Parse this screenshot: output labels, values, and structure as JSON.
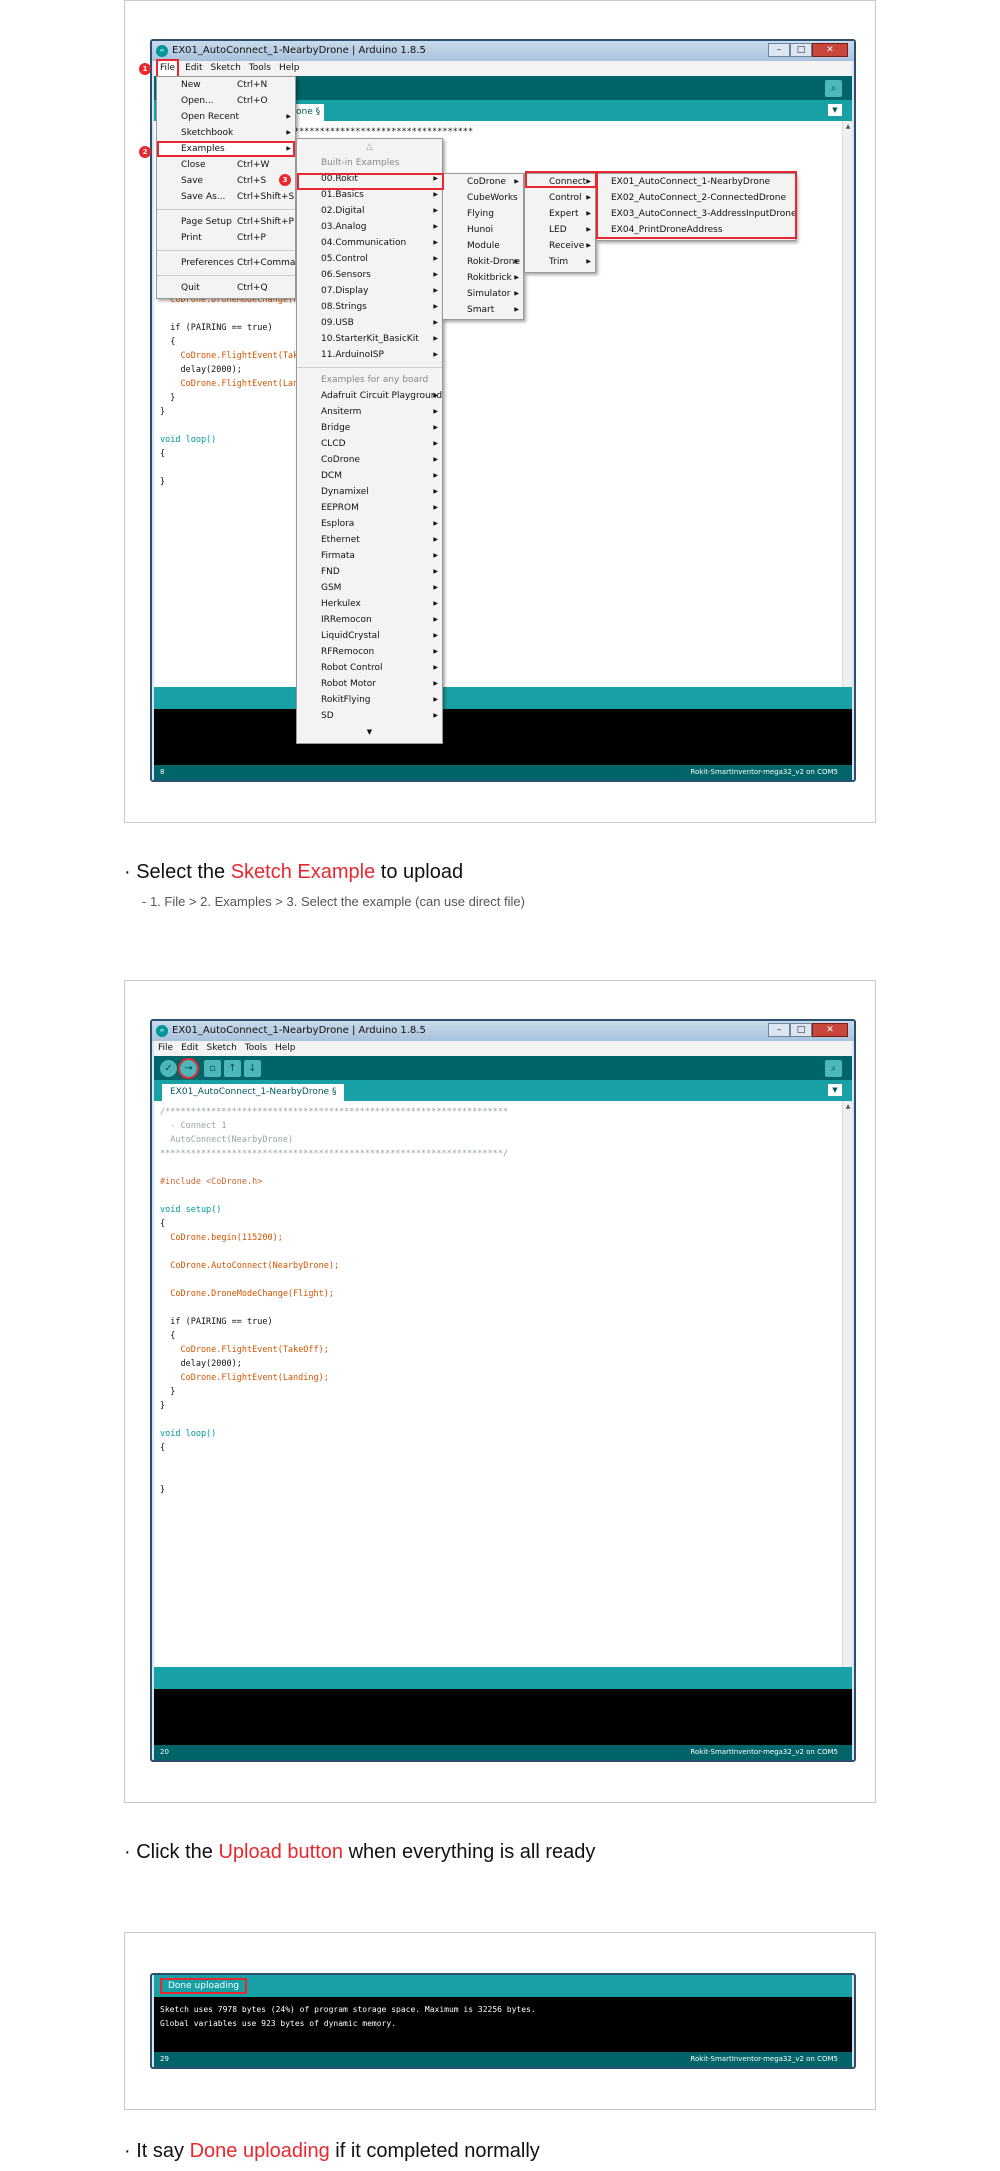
{
  "window": {
    "title": "EX01_AutoConnect_1-NearbyDrone | Arduino 1.8.5",
    "app_icon": "∞",
    "controls": {
      "minimize": "–",
      "maximize": "□",
      "close": "✕"
    }
  },
  "menubar": {
    "file": "File",
    "edit": "Edit",
    "sketch": "Sketch",
    "tools": "Tools",
    "help": "Help"
  },
  "toolbar": {
    "verify": "✓",
    "upload": "→",
    "new": "▫",
    "open": "↑",
    "save": "↓",
    "serial_monitor": "⌕"
  },
  "tab": {
    "name": "EX01_AutoConnect_1-NearbyDrone §",
    "name_partial": "one §",
    "menu": "▼"
  },
  "file_menu": {
    "items": [
      {
        "label": "New",
        "shortcut": "Ctrl+N"
      },
      {
        "label": "Open...",
        "shortcut": "Ctrl+O"
      },
      {
        "label": "Open Recent",
        "shortcut": ""
      },
      {
        "label": "Sketchbook",
        "shortcut": ""
      },
      {
        "label": "Examples",
        "shortcut": ""
      },
      {
        "label": "Close",
        "shortcut": "Ctrl+W"
      },
      {
        "label": "Save",
        "shortcut": "Ctrl+S"
      },
      {
        "label": "Save As...",
        "shortcut": "Ctrl+Shift+S"
      },
      {
        "label": "Page Setup",
        "shortcut": "Ctrl+Shift+P"
      },
      {
        "label": "Print",
        "shortcut": "Ctrl+P"
      },
      {
        "label": "Preferences",
        "shortcut": "Ctrl+Comma"
      },
      {
        "label": "Quit",
        "shortcut": "Ctrl+Q"
      }
    ]
  },
  "examples_menu": {
    "scroll_up": "△",
    "scroll_down": "▼",
    "builtin_header": "Built-in Examples",
    "builtin": [
      "00.Rokit",
      "01.Basics",
      "02.Digital",
      "03.Analog",
      "04.Communication",
      "05.Control",
      "06.Sensors",
      "07.Display",
      "08.Strings",
      "09.USB",
      "10.StarterKit_BasicKit",
      "11.ArduinoISP"
    ],
    "board_header": "Examples for any board",
    "board": [
      "Adafruit Circuit Playground",
      "Ansiterm",
      "Bridge",
      "CLCD",
      "CoDrone",
      "DCM",
      "Dynamixel",
      "EEPROM",
      "Esplora",
      "Ethernet",
      "Firmata",
      "FND",
      "GSM",
      "Herkulex",
      "IRRemocon",
      "LiquidCrystal",
      "RFRemocon",
      "Robot Control",
      "Robot Motor",
      "RokitFlying",
      "SD"
    ]
  },
  "rokit_menu": [
    "CoDrone",
    "CubeWorks",
    "Flying",
    "Hunoi",
    "Module",
    "Rokit-Drone",
    "Rokitbrick",
    "Simulator",
    "Smart"
  ],
  "codrone_menu": [
    "Connect",
    "Control",
    "Expert",
    "LED",
    "Receive",
    "Trim"
  ],
  "connect_menu": [
    "EX01_AutoConnect_1-NearbyDrone",
    "EX02_AutoConnect_2-ConnectedDrone",
    "EX03_AutoConnect_3-AddressInputDrone",
    "EX04_PrintDroneAddress"
  ],
  "steps": {
    "one": "1",
    "two": "2",
    "three": "3"
  },
  "code": {
    "comment_start": "/*******************************************************************",
    "comment_start_partial": "***********************************",
    "comment_title": "  - Connect 1",
    "comment_sub": "  AutoConnect(NearbyDrone)",
    "comment_end": "*******************************************************************/",
    "include": "#include <CoDrone.h>",
    "setup_sig": "void setup()",
    "open_brace": "{",
    "begin": "  CoDrone.begin(115200);",
    "autoconnect": "  CoDrone.AutoConnect(NearbyDrone);",
    "modechange": "  CoDrone.DroneModeChange(Flight);",
    "modechange_partial": "  CoDrone.DroneModeChange(Fli",
    "if_line": "  if (PAIRING == true)",
    "inner_open": "  {",
    "takeoff": "    CoDrone.FlightEvent(TakeOff);",
    "takeoff_partial": "    CoDrone.FlightEvent(TakeO",
    "delay": "    delay(2000);",
    "landing": "    CoDrone.FlightEvent(Landing);",
    "landing_partial": "    CoDrone.FlightEvent(Landi",
    "inner_close": "  }",
    "close_brace": "}",
    "loop_sig": "void loop()"
  },
  "footer": {
    "line_1": "8",
    "line_2": "20",
    "line_3": "29",
    "board": "Rokit-SmartInventor-mega32_v2 on COM5"
  },
  "upload_status": {
    "message": "Done uploading",
    "console_line1": "Sketch uses 7978 bytes (24%) of program storage space. Maximum is 32256 bytes.",
    "console_line2": "Global variables use 923 bytes of dynamic memory."
  },
  "captions": {
    "c1_pre": "· Select the ",
    "c1_hl": "Sketch Example",
    "c1_post": " to upload",
    "c1_sub": "- 1. File  >  2. Examples  >  3. Select the example (can use direct file)",
    "c2_pre": "· Click the ",
    "c2_hl": "Upload button",
    "c2_post": " when everything is all ready",
    "c3_pre": "· It say ",
    "c3_hl": "Done uploading",
    "c3_post": " if it completed normally"
  },
  "colors": {
    "accent": "#e8282e",
    "arduino_teal": "#17a1a5",
    "arduino_dark": "#006468"
  }
}
